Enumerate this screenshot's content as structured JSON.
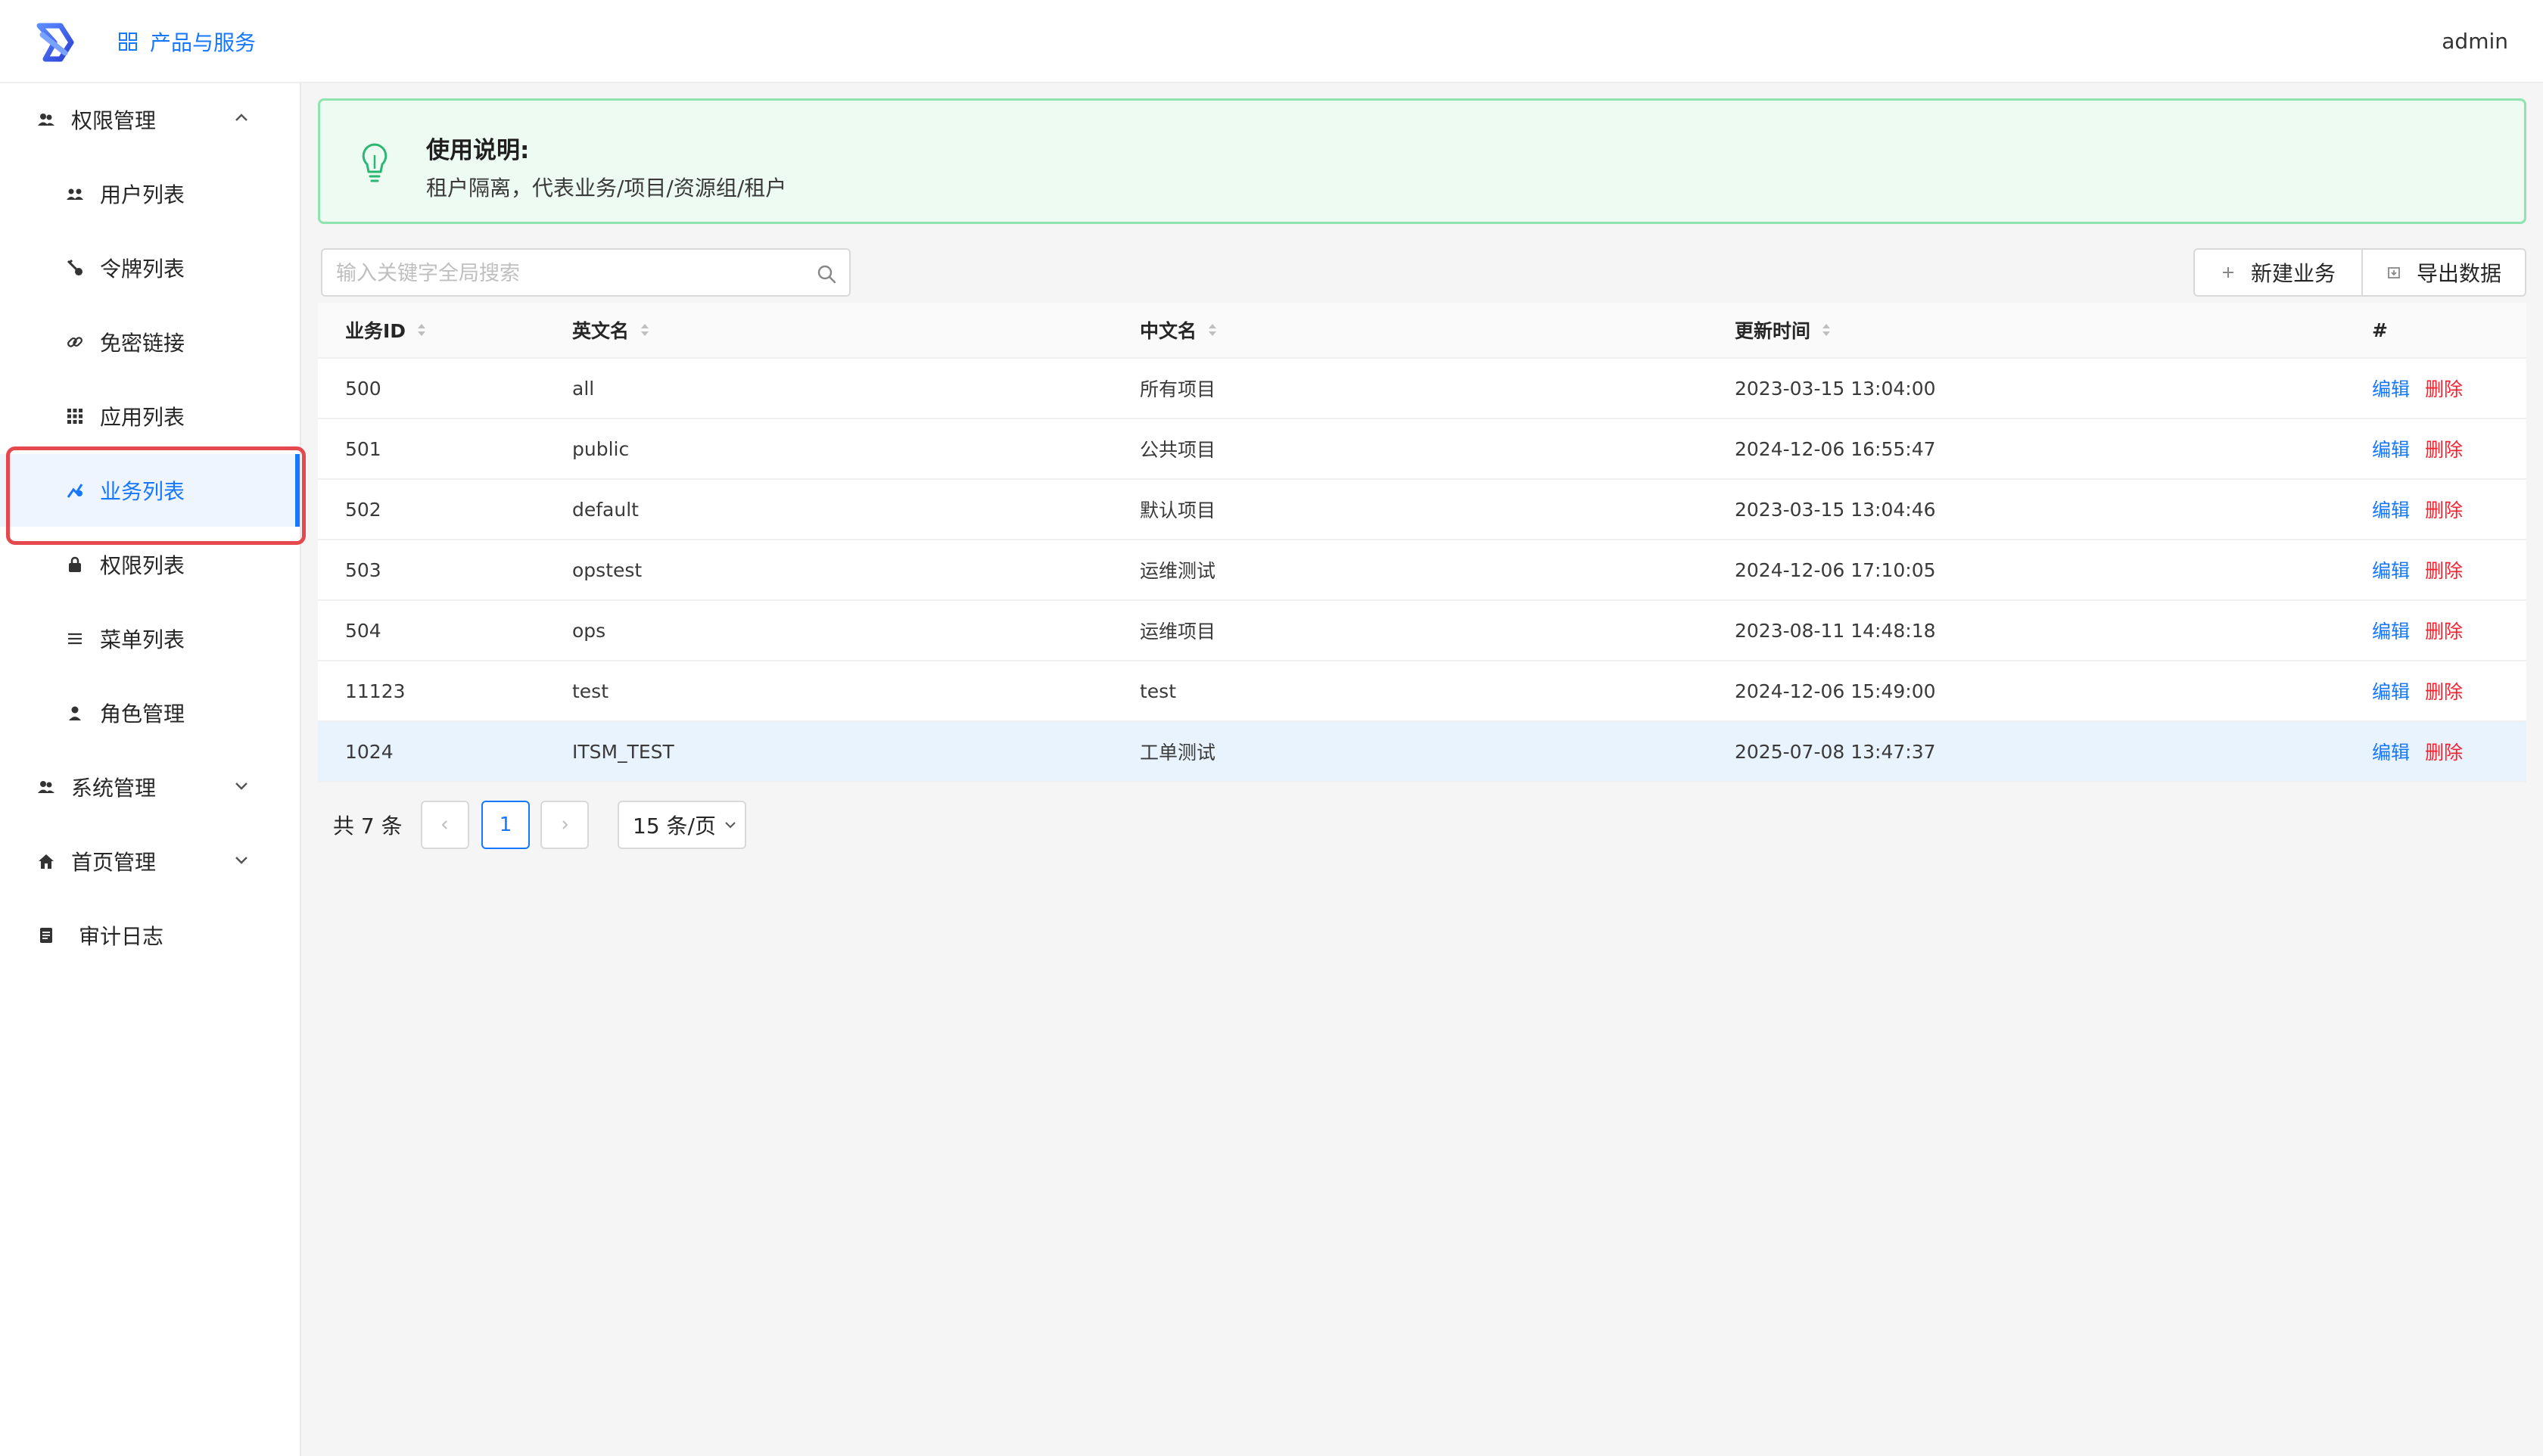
{
  "header": {
    "products_label": "产品与服务",
    "user_name": "admin"
  },
  "sidebar": {
    "items": [
      {
        "label": "权限管理",
        "icon": "team-icon",
        "level": "top",
        "expanded": true
      },
      {
        "label": "用户列表",
        "icon": "users-icon",
        "level": "sub"
      },
      {
        "label": "令牌列表",
        "icon": "key-icon",
        "level": "sub"
      },
      {
        "label": "免密链接",
        "icon": "link-icon",
        "level": "sub"
      },
      {
        "label": "应用列表",
        "icon": "apps-icon",
        "level": "sub"
      },
      {
        "label": "业务列表",
        "icon": "business-icon",
        "level": "sub",
        "active": true
      },
      {
        "label": "权限列表",
        "icon": "lock-icon",
        "level": "sub"
      },
      {
        "label": "菜单列表",
        "icon": "menu-icon",
        "level": "sub"
      },
      {
        "label": "角色管理",
        "icon": "user-icon",
        "level": "sub"
      },
      {
        "label": "系统管理",
        "icon": "team-icon",
        "level": "top",
        "expanded": false
      },
      {
        "label": "首页管理",
        "icon": "home-icon",
        "level": "top",
        "expanded": false
      },
      {
        "label": "审计日志",
        "icon": "log-icon",
        "level": "top"
      }
    ]
  },
  "alert": {
    "title": "使用说明:",
    "description": "租户隔离，代表业务/项目/资源组/租户"
  },
  "toolbar": {
    "search_placeholder": "输入关键字全局搜索",
    "new_button": "新建业务",
    "export_button": "导出数据"
  },
  "table": {
    "columns": [
      "业务ID",
      "英文名",
      "中文名",
      "更新时间",
      "#"
    ],
    "rows": [
      {
        "id": "500",
        "en": "all",
        "cn": "所有项目",
        "updated": "2023-03-15 13:04:00"
      },
      {
        "id": "501",
        "en": "public",
        "cn": "公共项目",
        "updated": "2024-12-06 16:55:47"
      },
      {
        "id": "502",
        "en": "default",
        "cn": "默认项目",
        "updated": "2023-03-15 13:04:46"
      },
      {
        "id": "503",
        "en": "opstest",
        "cn": "运维测试",
        "updated": "2024-12-06 17:10:05"
      },
      {
        "id": "504",
        "en": "ops",
        "cn": "运维项目",
        "updated": "2023-08-11 14:48:18"
      },
      {
        "id": "11123",
        "en": "test",
        "cn": "test",
        "updated": "2024-12-06 15:49:00"
      },
      {
        "id": "1024",
        "en": "ITSM_TEST",
        "cn": "工单测试",
        "updated": "2025-07-08 13:47:37"
      }
    ],
    "edit_label": "编辑",
    "delete_label": "删除"
  },
  "pagination": {
    "total_text": "共 7 条",
    "current_page": "1",
    "page_size": "15 条/页"
  },
  "colors": {
    "primary": "#1677ff",
    "danger": "#f5222d",
    "alert_bg": "#edfbf2",
    "alert_border": "#8fe3ae",
    "highlight_box": "#e5484d"
  }
}
